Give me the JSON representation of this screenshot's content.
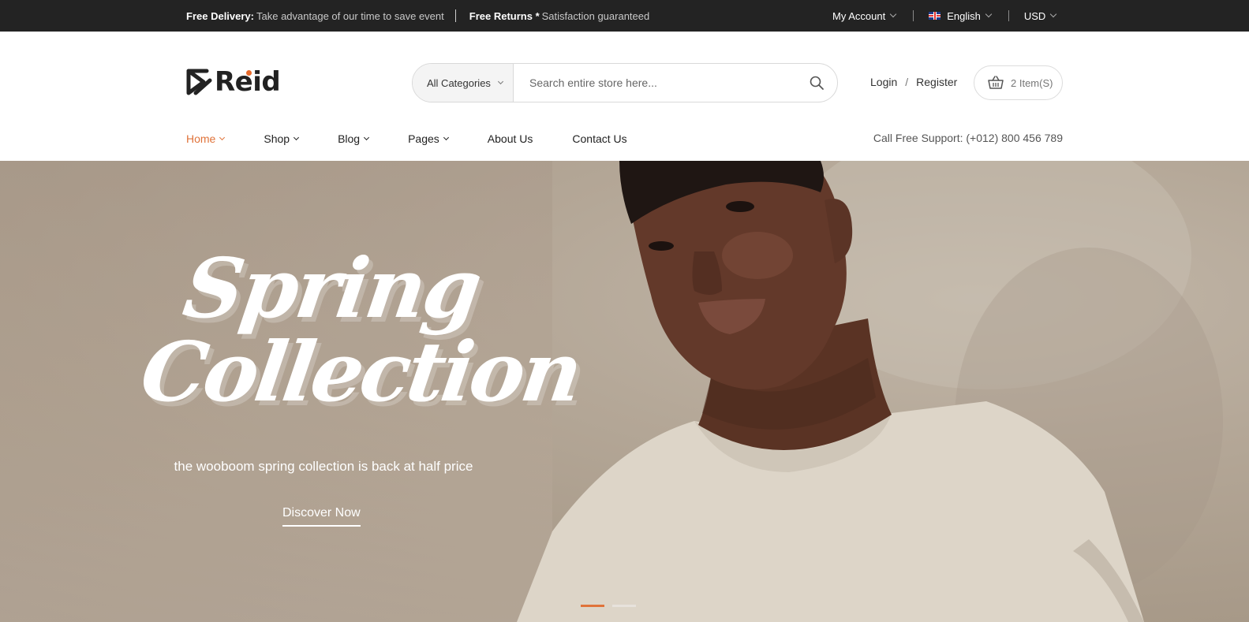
{
  "topbar": {
    "delivery_label": "Free Delivery:",
    "delivery_text": "Take advantage of our time to save event",
    "returns_label": "Free Returns *",
    "returns_text": "Satisfaction guaranteed",
    "account": "My Account",
    "language": "English",
    "currency": "USD"
  },
  "header": {
    "logo_text": "Reid",
    "search": {
      "category": "All Categories",
      "placeholder": "Search entire store here..."
    },
    "login": "Login",
    "slash": "/",
    "register": "Register",
    "cart_label": "2 Item(S)"
  },
  "nav": {
    "items": [
      {
        "label": "Home",
        "dropdown": true,
        "active": true
      },
      {
        "label": "Shop",
        "dropdown": true
      },
      {
        "label": "Blog",
        "dropdown": true
      },
      {
        "label": "Pages",
        "dropdown": true
      },
      {
        "label": "About Us",
        "dropdown": false
      },
      {
        "label": "Contact Us",
        "dropdown": false
      }
    ],
    "support": "Call Free Support: (+012) 800 456 789"
  },
  "hero": {
    "title_line1": "Spring",
    "title_line2": "Collection",
    "subtitle": "the wooboom spring collection is back at half price",
    "cta": "Discover Now",
    "slide_active": 1,
    "slide_count": 2
  },
  "colors": {
    "accent": "#e0733a",
    "topbar_bg": "#232323",
    "hero_bg": "#b4a797"
  }
}
